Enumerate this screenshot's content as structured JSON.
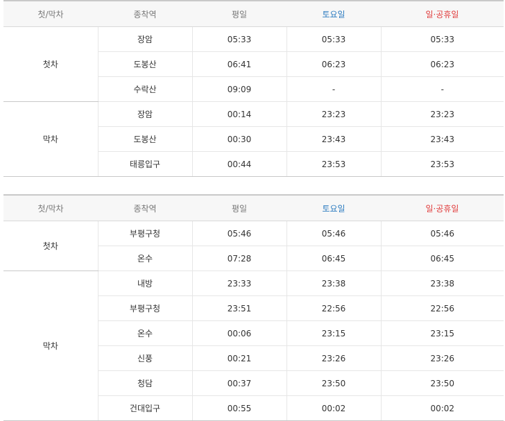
{
  "headers": {
    "type": "첫/막차",
    "station": "종착역",
    "weekday": "평일",
    "saturday": "토요일",
    "holiday": "일·공휴일"
  },
  "colors": {
    "saturday": "#2b7bc0",
    "holiday": "#e03b3b"
  },
  "table1": {
    "first_label": "첫차",
    "last_label": "막차",
    "first": [
      {
        "station": "장암",
        "weekday": "05:33",
        "saturday": "05:33",
        "holiday": "05:33"
      },
      {
        "station": "도봉산",
        "weekday": "06:41",
        "saturday": "06:23",
        "holiday": "06:23"
      },
      {
        "station": "수락산",
        "weekday": "09:09",
        "saturday": "-",
        "holiday": "-"
      }
    ],
    "last": [
      {
        "station": "장암",
        "weekday": "00:14",
        "saturday": "23:23",
        "holiday": "23:23"
      },
      {
        "station": "도봉산",
        "weekday": "00:30",
        "saturday": "23:43",
        "holiday": "23:43"
      },
      {
        "station": "태릉입구",
        "weekday": "00:44",
        "saturday": "23:53",
        "holiday": "23:53"
      }
    ]
  },
  "table2": {
    "first_label": "첫차",
    "last_label": "막차",
    "first": [
      {
        "station": "부평구청",
        "weekday": "05:46",
        "saturday": "05:46",
        "holiday": "05:46"
      },
      {
        "station": "온수",
        "weekday": "07:28",
        "saturday": "06:45",
        "holiday": "06:45"
      }
    ],
    "last": [
      {
        "station": "내방",
        "weekday": "23:33",
        "saturday": "23:38",
        "holiday": "23:38"
      },
      {
        "station": "부평구청",
        "weekday": "23:51",
        "saturday": "22:56",
        "holiday": "22:56"
      },
      {
        "station": "온수",
        "weekday": "00:06",
        "saturday": "23:15",
        "holiday": "23:15"
      },
      {
        "station": "신풍",
        "weekday": "00:21",
        "saturday": "23:26",
        "holiday": "23:26"
      },
      {
        "station": "청담",
        "weekday": "00:37",
        "saturday": "23:50",
        "holiday": "23:50"
      },
      {
        "station": "건대입구",
        "weekday": "00:55",
        "saturday": "00:02",
        "holiday": "00:02"
      }
    ]
  }
}
